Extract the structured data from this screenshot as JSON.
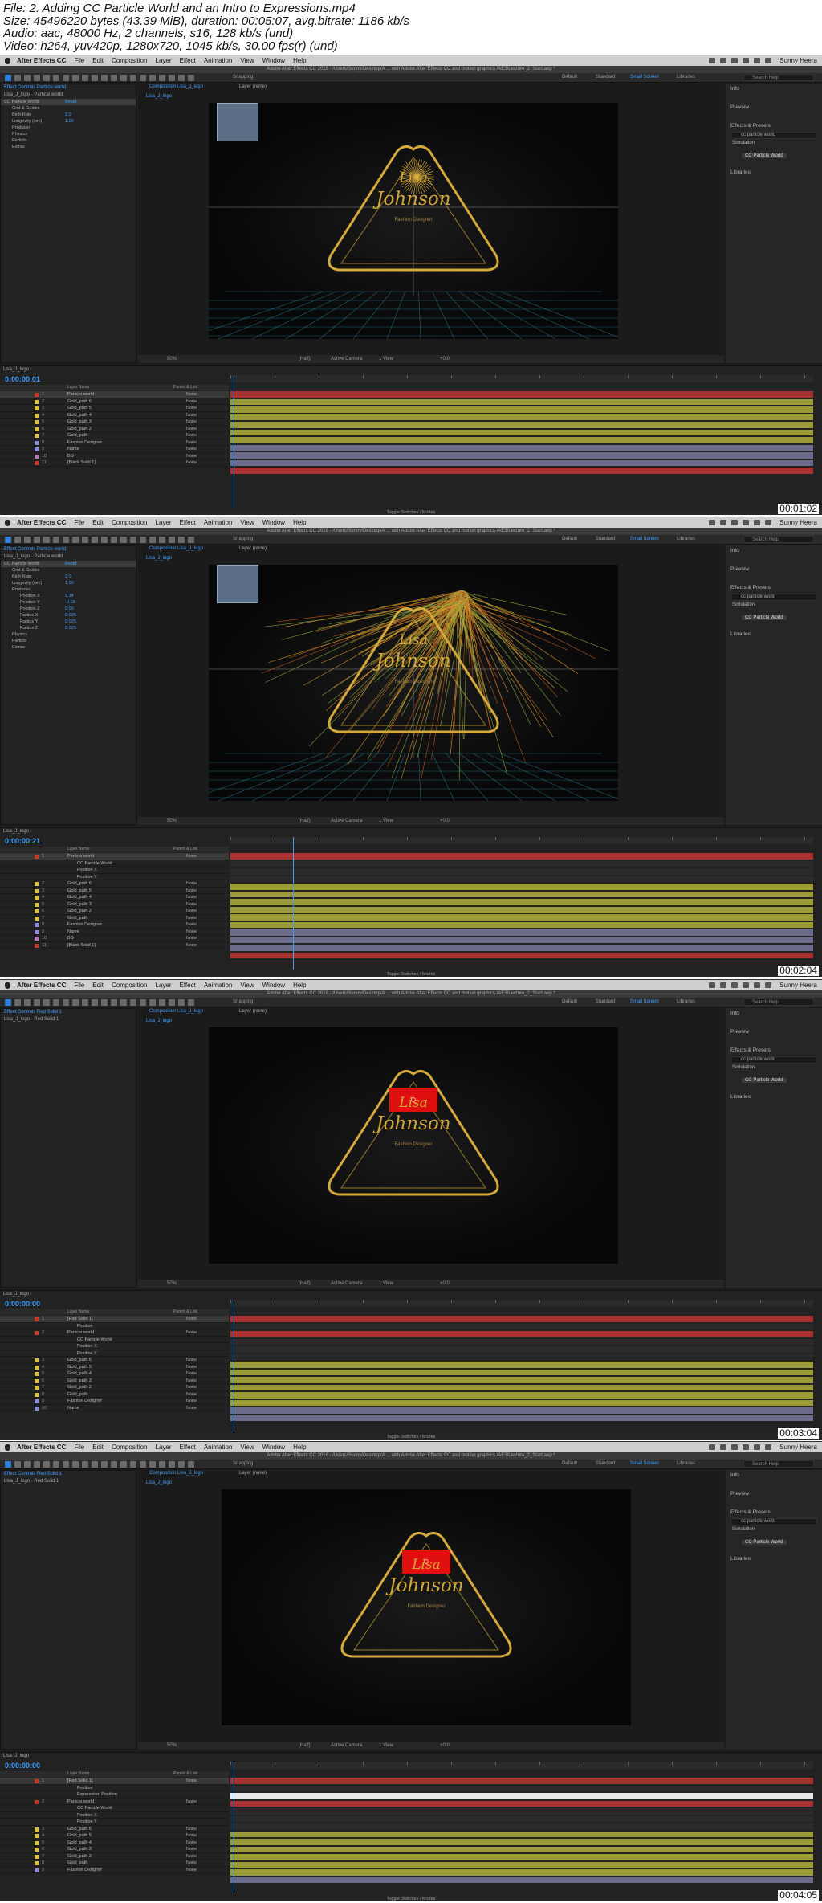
{
  "header": {
    "file": "File: 2. Adding CC Particle World and an Intro to Expressions.mp4",
    "size": "Size: 45496220 bytes (43.39 MiB), duration: 00:05:07, avg.bitrate: 1186 kb/s",
    "audio": "Audio: aac, 48000 Hz, 2 channels, s16, 128 kb/s (und)",
    "video": "Video: h264, yuv420p, 1280x720, 1045 kb/s, 30.00 fps(r) (und)"
  },
  "menubar": {
    "app": "After Effects CC",
    "items": [
      "File",
      "Edit",
      "Composition",
      "Layer",
      "Effect",
      "Animation",
      "View",
      "Window",
      "Help"
    ],
    "user": "Sunny Heera"
  },
  "titlebar": "Adobe After Effects CC 2018 - /Users/Sunny/Desktop/A ... with Adobe After Effects CC and motion graphics./AE3/Lecture_2_Start.aep *",
  "workspaces": [
    "Default",
    "Standard",
    "Small Screen",
    "Libraries"
  ],
  "search_help": "Search Help",
  "right_panel": {
    "info": "Info",
    "preview": "Preview",
    "effects_presets": "Effects & Presets",
    "search_value": "cc particle world",
    "simulation": "Simulation",
    "effect_name": "CC Particle World",
    "libraries": "Libraries"
  },
  "viewer": {
    "comp_tab": "Composition Lisa_J_logo",
    "layer_tab": "Layer (none)",
    "sub_tab": "Lisa_J_logo",
    "snapping": "Snapping",
    "zoom": "50%",
    "resolution": "(Half)",
    "camera": "Active Camera",
    "views": "1 View",
    "offset": "+0.0",
    "logo_line1": "Lisa",
    "logo_line2": "Johnson",
    "logo_sub": "Fashion Designer"
  },
  "timeline_common": {
    "tab": "Lisa_J_logo",
    "layer_name_col": "Layer Name",
    "parent_col": "Parent & Link",
    "footer": "Toggle Switches / Modes",
    "none": "None",
    "reset": "Reset"
  },
  "frames": [
    {
      "timestamp": "00:01:02",
      "timecode": "0:00:00:01",
      "effect_controls": "Effect Controls Particle world",
      "ec_path": "Lisa_J_logo - Particle world",
      "props": [
        {
          "name": "CC Particle World",
          "val": "Reset"
        },
        {
          "name": "Grid & Guides",
          "val": ""
        },
        {
          "name": "Birth Rate",
          "val": "2.0"
        },
        {
          "name": "Longevity (sec)",
          "val": "1.00"
        },
        {
          "name": "Producer",
          "val": ""
        },
        {
          "name": "Physics",
          "val": ""
        },
        {
          "name": "Particle",
          "val": ""
        },
        {
          "name": "Extras",
          "val": ""
        }
      ],
      "layers": [
        {
          "n": "1",
          "name": "Particle world",
          "color": "#c0392b"
        },
        {
          "n": "2",
          "name": "Gold_path 6",
          "color": "#d6c243"
        },
        {
          "n": "3",
          "name": "Gold_path 5",
          "color": "#d6c243"
        },
        {
          "n": "4",
          "name": "Gold_path 4",
          "color": "#d6c243"
        },
        {
          "n": "5",
          "name": "Gold_path 3",
          "color": "#d6c243"
        },
        {
          "n": "6",
          "name": "Gold_path 2",
          "color": "#d6c243"
        },
        {
          "n": "7",
          "name": "Gold_path",
          "color": "#d6c243"
        },
        {
          "n": "8",
          "name": "Fashion Designer",
          "color": "#8b8bd6"
        },
        {
          "n": "9",
          "name": "Name",
          "color": "#8b8bd6"
        },
        {
          "n": "10",
          "name": "BG",
          "color": "#b07ab0"
        },
        {
          "n": "11",
          "name": "[Black Solid 1]",
          "color": "#c0392b"
        }
      ]
    },
    {
      "timestamp": "00:02:04",
      "timecode": "0:00:00:21",
      "effect_controls": "Effect Controls Particle world",
      "ec_path": "Lisa_J_logo - Particle world",
      "props": [
        {
          "name": "CC Particle World",
          "val": "Reset"
        },
        {
          "name": "Grid & Guides",
          "val": ""
        },
        {
          "name": "Birth Rate",
          "val": "2.0"
        },
        {
          "name": "Longevity (sec)",
          "val": "1.00"
        },
        {
          "name": "Producer",
          "val": ""
        },
        {
          "name": "Position X",
          "val": "0.14"
        },
        {
          "name": "Position Y",
          "val": "-0.19"
        },
        {
          "name": "Position Z",
          "val": "0.00"
        },
        {
          "name": "Radius X",
          "val": "0.025"
        },
        {
          "name": "Radius Y",
          "val": "0.025"
        },
        {
          "name": "Radius Z",
          "val": "0.025"
        },
        {
          "name": "Physics",
          "val": ""
        },
        {
          "name": "Particle",
          "val": ""
        },
        {
          "name": "Extras",
          "val": ""
        }
      ],
      "layers": [
        {
          "n": "1",
          "name": "Particle world",
          "color": "#c0392b"
        },
        {
          "n": "",
          "name": "CC Particle World",
          "color": ""
        },
        {
          "n": "",
          "name": "Position X",
          "color": ""
        },
        {
          "n": "",
          "name": "Position Y",
          "color": ""
        },
        {
          "n": "2",
          "name": "Gold_path 6",
          "color": "#d6c243"
        },
        {
          "n": "3",
          "name": "Gold_path 5",
          "color": "#d6c243"
        },
        {
          "n": "4",
          "name": "Gold_path 4",
          "color": "#d6c243"
        },
        {
          "n": "5",
          "name": "Gold_path 3",
          "color": "#d6c243"
        },
        {
          "n": "6",
          "name": "Gold_path 2",
          "color": "#d6c243"
        },
        {
          "n": "7",
          "name": "Gold_path",
          "color": "#d6c243"
        },
        {
          "n": "8",
          "name": "Fashion Designer",
          "color": "#8b8bd6"
        },
        {
          "n": "9",
          "name": "Name",
          "color": "#8b8bd6"
        },
        {
          "n": "10",
          "name": "BG",
          "color": "#b07ab0"
        },
        {
          "n": "11",
          "name": "[Black Solid 1]",
          "color": "#c0392b"
        }
      ]
    },
    {
      "timestamp": "00:03:04",
      "timecode": "0:00:00:00",
      "effect_controls": "Effect Controls Red Solid 1",
      "ec_path": "Lisa_J_logo - Red Solid 1",
      "props": [],
      "layers": [
        {
          "n": "1",
          "name": "[Red Solid 1]",
          "color": "#c0392b"
        },
        {
          "n": "",
          "name": "Position",
          "color": ""
        },
        {
          "n": "2",
          "name": "Particle world",
          "color": "#c0392b"
        },
        {
          "n": "",
          "name": "CC Particle World",
          "color": ""
        },
        {
          "n": "",
          "name": "Position X",
          "color": ""
        },
        {
          "n": "",
          "name": "Position Y",
          "color": ""
        },
        {
          "n": "3",
          "name": "Gold_path 6",
          "color": "#d6c243"
        },
        {
          "n": "4",
          "name": "Gold_path 5",
          "color": "#d6c243"
        },
        {
          "n": "5",
          "name": "Gold_path 4",
          "color": "#d6c243"
        },
        {
          "n": "6",
          "name": "Gold_path 3",
          "color": "#d6c243"
        },
        {
          "n": "7",
          "name": "Gold_path 2",
          "color": "#d6c243"
        },
        {
          "n": "8",
          "name": "Gold_path",
          "color": "#d6c243"
        },
        {
          "n": "9",
          "name": "Fashion Designer",
          "color": "#8b8bd6"
        },
        {
          "n": "10",
          "name": "Name",
          "color": "#8b8bd6"
        }
      ]
    },
    {
      "timestamp": "00:04:05",
      "timecode": "0:00:00:00",
      "effect_controls": "Effect Controls Red Solid 1",
      "ec_path": "Lisa_J_logo - Red Solid 1",
      "props": [],
      "layers": [
        {
          "n": "1",
          "name": "[Red Solid 1]",
          "color": "#c0392b"
        },
        {
          "n": "",
          "name": "Position",
          "color": ""
        },
        {
          "n": "",
          "name": "Expression: Position",
          "color": ""
        },
        {
          "n": "2",
          "name": "Particle world",
          "color": "#c0392b"
        },
        {
          "n": "",
          "name": "CC Particle World",
          "color": ""
        },
        {
          "n": "",
          "name": "Position X",
          "color": ""
        },
        {
          "n": "",
          "name": "Position Y",
          "color": ""
        },
        {
          "n": "3",
          "name": "Gold_path 6",
          "color": "#d6c243"
        },
        {
          "n": "4",
          "name": "Gold_path 5",
          "color": "#d6c243"
        },
        {
          "n": "5",
          "name": "Gold_path 4",
          "color": "#d6c243"
        },
        {
          "n": "6",
          "name": "Gold_path 3",
          "color": "#d6c243"
        },
        {
          "n": "7",
          "name": "Gold_path 2",
          "color": "#d6c243"
        },
        {
          "n": "8",
          "name": "Gold_path",
          "color": "#d6c243"
        },
        {
          "n": "9",
          "name": "Fashion Designer",
          "color": "#8b8bd6"
        }
      ]
    }
  ],
  "colors": {
    "accent": "#3fa0ff",
    "gold": "#d4a93c",
    "track_yellow": "#9a9a36",
    "track_red": "#a83232",
    "track_purple": "#6b6b8c",
    "solid_red": "#e01010"
  }
}
